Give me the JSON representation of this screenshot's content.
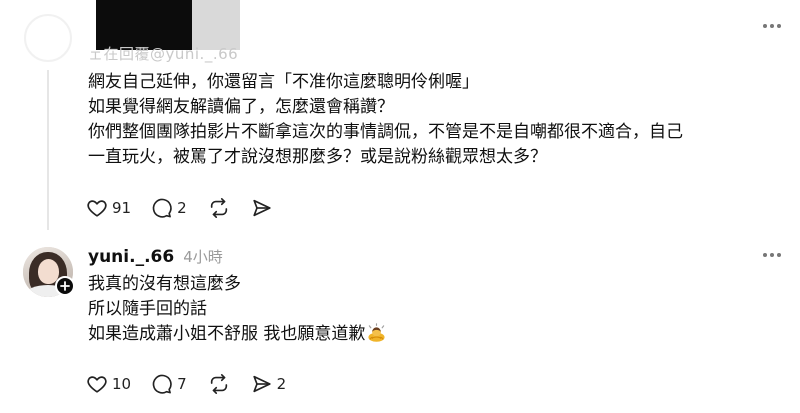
{
  "top_post": {
    "username_partial": "ェ在回覆@yuni._.66"
  },
  "comment1": {
    "lines": [
      "網友自己延伸，你還留言「不准你這麼聰明伶俐喔」",
      "如果覺得網友解讀偏了，怎麼還會稱讚？",
      "你們整個團隊拍影片不斷拿這次的事情調侃，不管是不是自嘲都很不適合，自己",
      "一直玩火，被罵了才說沒想那麼多？或是說粉絲觀眾想太多？"
    ],
    "likes": "91",
    "replies": "2",
    "reposts": "",
    "shares": ""
  },
  "comment2": {
    "username": "yuni._.66",
    "time": "4小時",
    "lines": [
      "我真的沒有想這麼多",
      "所以隨手回的話",
      "如果造成蕭小姐不舒服 我也願意道歉"
    ],
    "emoji": "bowing-person-emoji",
    "likes": "10",
    "replies": "7",
    "reposts": "",
    "shares": "2"
  },
  "icons": {
    "like": "heart-icon",
    "reply": "comment-bubble-icon",
    "repost": "repost-icon",
    "share": "send-icon",
    "more": "more-horizontal-icon",
    "follow": "plus-icon"
  },
  "colors": {
    "text": "#101010",
    "muted": "#9a9a9a",
    "thread_line": "#e6e6e6"
  }
}
